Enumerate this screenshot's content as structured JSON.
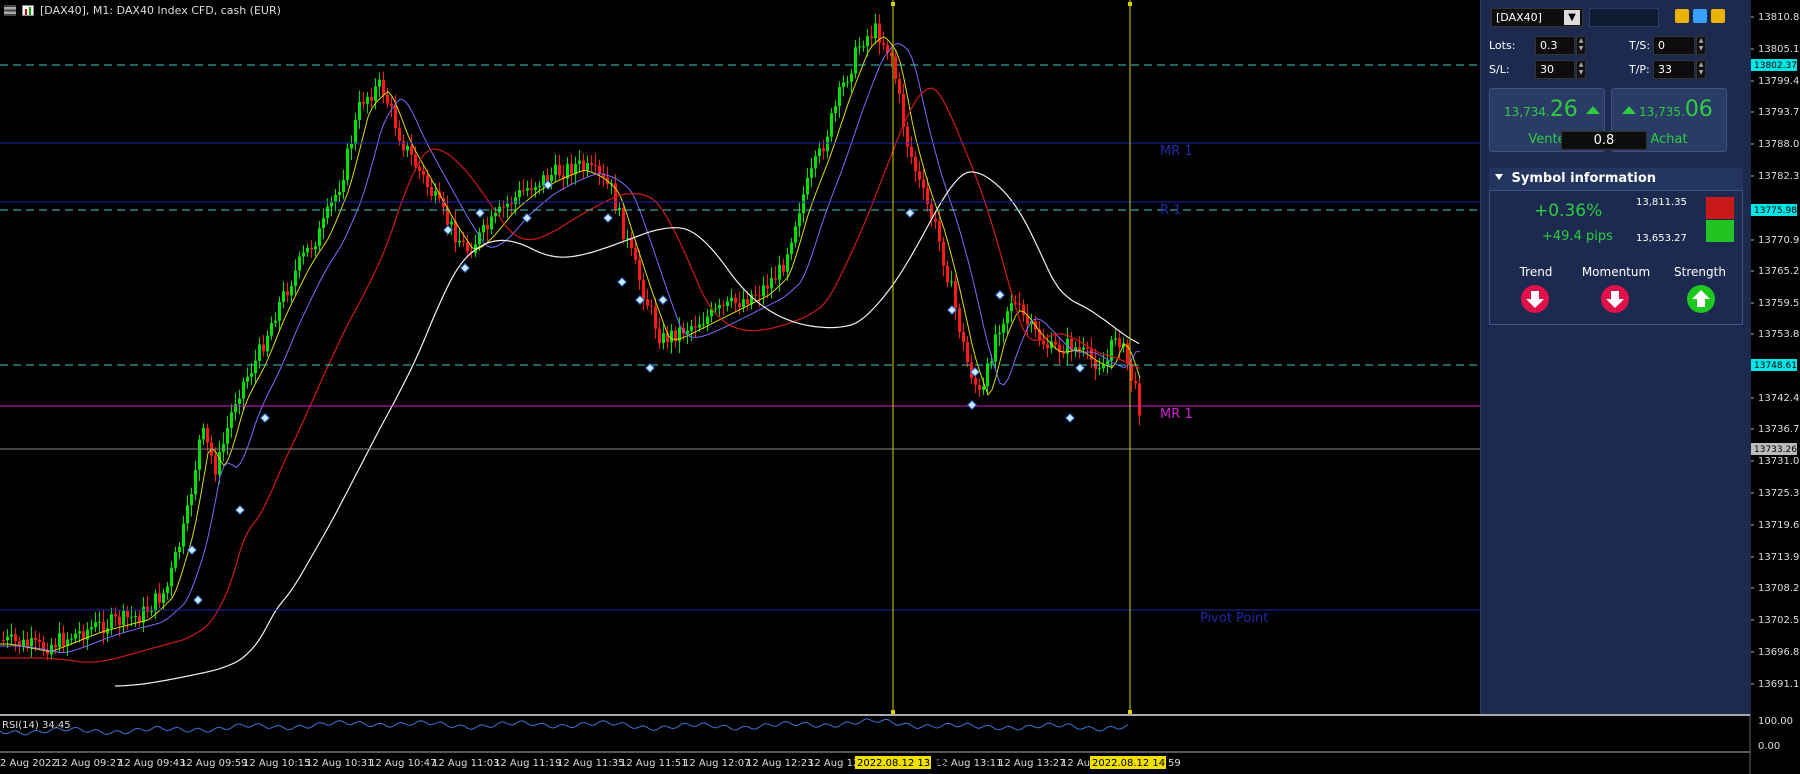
{
  "window": {
    "chart_title": "[DAX40], M1:  DAX40 Index CFD, cash (EUR)"
  },
  "price_axis": {
    "ticks": [
      "13810.80",
      "13805.10",
      "13799.40",
      "13793.70",
      "13788.00",
      "13782.30",
      "13770.90",
      "13765.20",
      "13759.50",
      "13753.80",
      "13742.40",
      "13736.70",
      "13731.00",
      "13725.30",
      "13719.60",
      "13713.90",
      "13708.20",
      "13702.50",
      "13696.80",
      "13691.10"
    ],
    "tags": [
      {
        "label": "13802.37",
        "color": "#00e5e5"
      },
      {
        "label": "13775.98",
        "color": "#00e5e5"
      },
      {
        "label": "13748.61",
        "color": "#00e5e5"
      },
      {
        "label": "13733.26",
        "color": "#bbbbbb"
      }
    ]
  },
  "time_axis": {
    "ticks": [
      "2 Aug 2022",
      "12 Aug 09:27",
      "12 Aug 09:43",
      "12 Aug 09:59",
      "12 Aug 10:15",
      "12 Aug 10:31",
      "12 Aug 10:47",
      "12 Aug 11:03",
      "12 Aug 11:19",
      "12 Aug 11:35",
      "12 Aug 11:51",
      "12 Aug 12:07",
      "12 Aug 12:23",
      "12 Aug 12:",
      "12 Aug 13:11",
      "12 Aug 13:27",
      "12 Aug"
    ],
    "highlights": [
      {
        "label": "2022.08.12 13:00"
      },
      {
        "label": "2022.08.12 14:00"
      }
    ],
    "trailing": "59"
  },
  "levels": [
    {
      "label": "MR 1",
      "color": "#1e2aa8"
    },
    {
      "label": "R 1",
      "color": "#1e2aa8"
    },
    {
      "label": "MR 1",
      "color": "#d020d0"
    },
    {
      "label": "Pivot Point",
      "color": "#1e2aa8"
    }
  ],
  "rsi": {
    "label": "RSI(14) 34.45",
    "scale_top": "100.00",
    "scale_bottom": "0.00"
  },
  "panel": {
    "symbol": "[DAX40]",
    "lots_label": "Lots:",
    "lots_value": "0.3",
    "ts_label": "T/S:",
    "ts_value": "0",
    "sl_label": "S/L:",
    "sl_value": "30",
    "tp_label": "T/P:",
    "tp_value": "33",
    "sell": {
      "small": "13,734.",
      "big": "26",
      "label": "Vente"
    },
    "buy": {
      "small": "13,735.",
      "big": "06",
      "label": "Achat"
    },
    "spread": "0.8",
    "symbol_info": {
      "header": "Symbol information",
      "change_pct": "+0.36%",
      "change_pips": "+49.4 pips",
      "high": "13,811.35",
      "low": "13,653.27",
      "indicators": [
        {
          "label": "Trend",
          "direction": "down"
        },
        {
          "label": "Momentum",
          "direction": "down"
        },
        {
          "label": "Strength",
          "direction": "up"
        }
      ]
    }
  },
  "colors": {
    "bull": "#00e000",
    "bear": "#ff1a1a",
    "ma_fast": "#d8e000",
    "ma_mid": "#7a6cff",
    "ma_slow": "#d01818",
    "ma_long": "#f2f2f2",
    "cyan_level": "#3fc7c7",
    "vline": "#d8d000",
    "rsi": "#3a73d6"
  }
}
